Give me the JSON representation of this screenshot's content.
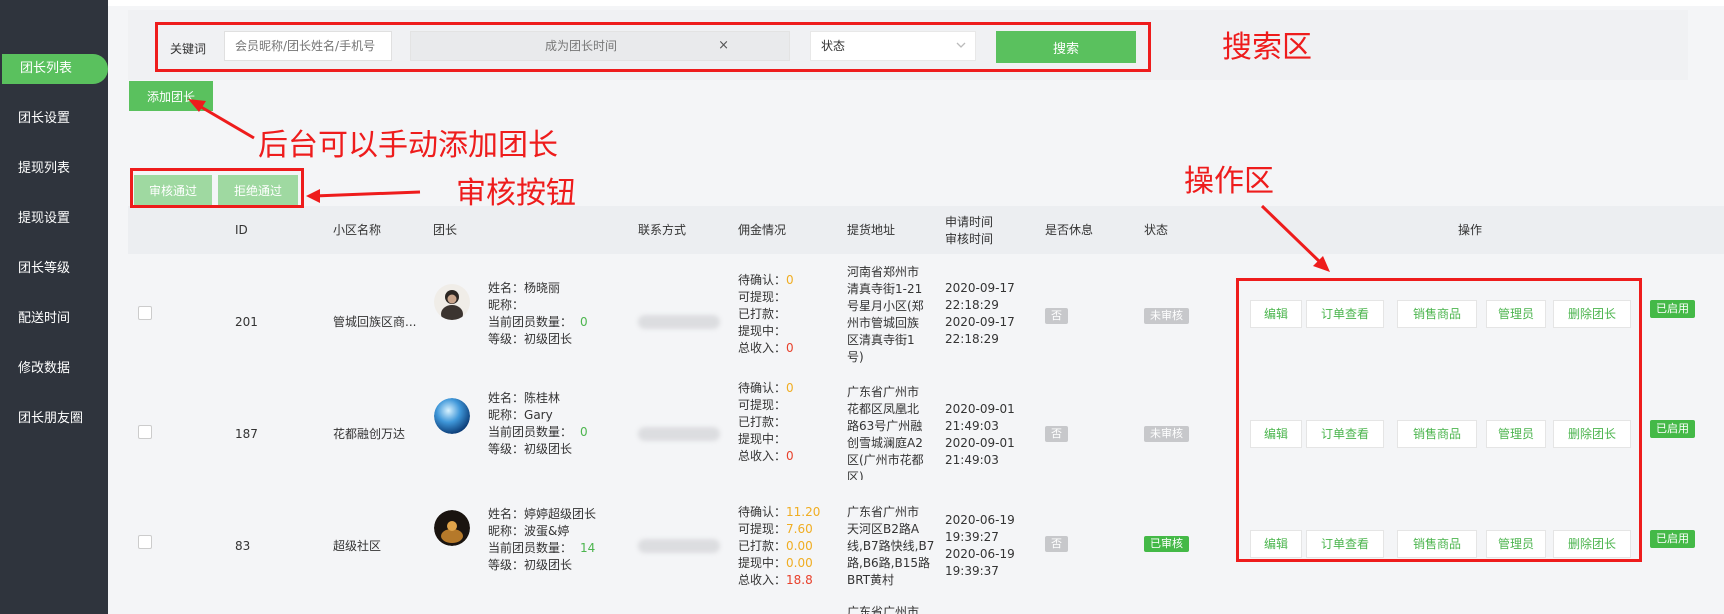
{
  "sidebar": {
    "items": [
      {
        "label": "团长列表",
        "active": true
      },
      {
        "label": "团长设置"
      },
      {
        "label": "提现列表"
      },
      {
        "label": "提现设置"
      },
      {
        "label": "团长等级"
      },
      {
        "label": "配送时间"
      },
      {
        "label": "修改数据"
      },
      {
        "label": "团长朋友圈"
      }
    ]
  },
  "search": {
    "keyword_label": "关键词",
    "keyword_placeholder": "会员昵称/团长姓名/手机号",
    "date_placeholder": "成为团长时间",
    "date_clear": "×",
    "status_value": "状态",
    "search_button": "搜索"
  },
  "actions": {
    "add_leader": "添加团长",
    "approve": "审核通过",
    "reject": "拒绝通过"
  },
  "table": {
    "headers": {
      "id": "ID",
      "community": "小区名称",
      "leader": "团长",
      "contact": "联系方式",
      "commission": "佣金情况",
      "address": "提货地址",
      "time_apply": "申请时间",
      "time_audit": "审核时间",
      "rest": "是否休息",
      "status": "状态",
      "operation": "操作"
    },
    "labels": {
      "name": "姓名：",
      "nick": "昵称：",
      "members": "当前团员数量：",
      "level": "等级：",
      "pending": "待确认：",
      "withdrawable": "可提现：",
      "paid": "已打款：",
      "withdrawing": "提现中：",
      "total": "总收入："
    },
    "ops": [
      "编辑",
      "订单查看",
      "销售商品",
      "管理员",
      "删除团长"
    ],
    "rows": [
      {
        "id": "201",
        "community": "管城回族区商...",
        "name": "杨晓丽",
        "nick": "",
        "members": "0",
        "level": "初级团长",
        "pending": "0",
        "withdrawable": "",
        "paid": "",
        "withdrawing": "",
        "total": "0",
        "address": [
          "河南省郑州市",
          "清真寺街1-21",
          "号星月小区(郑",
          "州市管城回族",
          "区清真寺街1",
          "号)"
        ],
        "apply_date": "2020-09-17",
        "apply_time": "22:18:29",
        "audit_date": "2020-09-17",
        "audit_time": "22:18:29",
        "rest": "否",
        "status": "未审核",
        "enabled": "已启用"
      },
      {
        "id": "187",
        "community": "花都融创万达",
        "name": "陈桂林",
        "nick": "Gary",
        "members": "0",
        "level": "初级团长",
        "pending": "0",
        "withdrawable": "",
        "paid": "",
        "withdrawing": "",
        "total": "0",
        "address": [
          "广东省广州市",
          "花都区凤凰北",
          "路63号广州融",
          "创雪城澜庭A2",
          "区(广州市花都",
          "区)"
        ],
        "apply_date": "2020-09-01",
        "apply_time": "21:49:03",
        "audit_date": "2020-09-01",
        "audit_time": "21:49:03",
        "rest": "否",
        "status": "未审核",
        "enabled": "已启用"
      },
      {
        "id": "83",
        "community": "超级社区",
        "name": "婷婷超级团长",
        "nick": "波蛋&婷",
        "members": "14",
        "level": "初级团长",
        "pending": "11.20",
        "withdrawable": "7.60",
        "paid": "0.00",
        "withdrawing": "0.00",
        "total": "18.8",
        "address": [
          "广东省广州市",
          "天河区B2路A",
          "线,B7路快线,B7",
          "路,B6路,B15路",
          "BRT黄村"
        ],
        "apply_date": "2020-06-19",
        "apply_time": "19:39:27",
        "audit_date": "2020-06-19",
        "audit_time": "19:39:37",
        "rest": "否",
        "status": "已审核",
        "enabled": "已启用"
      }
    ],
    "partial_address": "广东省广州市"
  },
  "annotations": {
    "search_area": "搜索区",
    "add_manual": "后台可以手动添加团长",
    "audit_buttons": "审核按钮",
    "operation_area": "操作区"
  },
  "colors": {
    "sidebar_bg": "#2f343d",
    "accent_green": "#5ac15e",
    "annotation_red": "#ee1c1c",
    "pending_yellow": "#f0ad22",
    "total_red": "#e8412c"
  }
}
